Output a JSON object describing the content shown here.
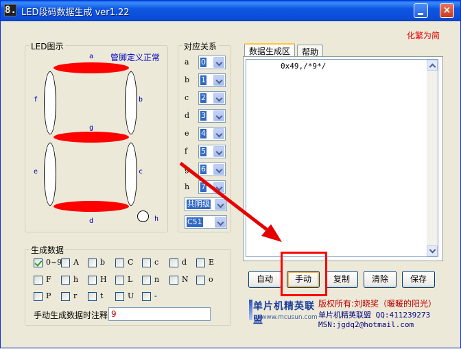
{
  "window": {
    "title": "LED段码数据生成 ver1.22",
    "app_icon_glyph": "8.",
    "close_glyph": "×"
  },
  "top_link": "化繁为简",
  "led_panel": {
    "legend": "LED图示",
    "status": "管脚定义正常",
    "segment_labels": {
      "a": "a",
      "b": "b",
      "c": "c",
      "d": "d",
      "e": "e",
      "f": "f",
      "g": "g",
      "h": "h"
    },
    "colors": {
      "lit": "#FF0000",
      "unlit": "#FFFFFF",
      "label": "#0000C0"
    }
  },
  "mapping": {
    "legend": "对应关系",
    "rows": [
      {
        "label": "a",
        "value": "0"
      },
      {
        "label": "b",
        "value": "1"
      },
      {
        "label": "c",
        "value": "2"
      },
      {
        "label": "d",
        "value": "3"
      },
      {
        "label": "e",
        "value": "4"
      },
      {
        "label": "f",
        "value": "5"
      },
      {
        "label": "g",
        "value": "6"
      },
      {
        "label": "h",
        "value": "7"
      }
    ],
    "polarity": "共阴级",
    "port": "C51"
  },
  "tabs": [
    {
      "label": "数据生成区",
      "active": true
    },
    {
      "label": "帮助",
      "active": false
    }
  ],
  "output_text": "0x49,/*9*/",
  "buttons": {
    "auto": "自动",
    "manual": "手动",
    "copy": "复制",
    "clear": "清除",
    "save": "保存"
  },
  "generate": {
    "legend": "生成数据",
    "options": [
      {
        "label": "0~9",
        "checked": true
      },
      {
        "label": "A",
        "checked": false
      },
      {
        "label": "b",
        "checked": false
      },
      {
        "label": "C",
        "checked": false
      },
      {
        "label": "c",
        "checked": false
      },
      {
        "label": "d",
        "checked": false
      },
      {
        "label": "E",
        "checked": false
      },
      {
        "label": "F",
        "checked": false
      },
      {
        "label": "h",
        "checked": false
      },
      {
        "label": "H",
        "checked": false
      },
      {
        "label": "L",
        "checked": false
      },
      {
        "label": "n",
        "checked": false
      },
      {
        "label": "N",
        "checked": false
      },
      {
        "label": "o",
        "checked": false
      },
      {
        "label": "P",
        "checked": false
      },
      {
        "label": "r",
        "checked": false
      },
      {
        "label": "t",
        "checked": false
      },
      {
        "label": "U",
        "checked": false
      },
      {
        "label": "-",
        "checked": false
      }
    ],
    "comment_label": "手动生成数据时注释",
    "comment_value": "9"
  },
  "footer": {
    "logo_title": "单片机精英联盟",
    "logo_url": "www.mcusun.com",
    "copyright": "版权所有:刘晓奖（暖暖的阳光）",
    "qq": "单片机精英联盟 QQ:411239273",
    "msn": "MSN:jgdq2@hotmail.com"
  },
  "colors": {
    "title_bar": "#0B4BD6",
    "link_red": "#E00000",
    "annotation_red": "#FF0000",
    "window_bg": "#ECE9D8"
  }
}
